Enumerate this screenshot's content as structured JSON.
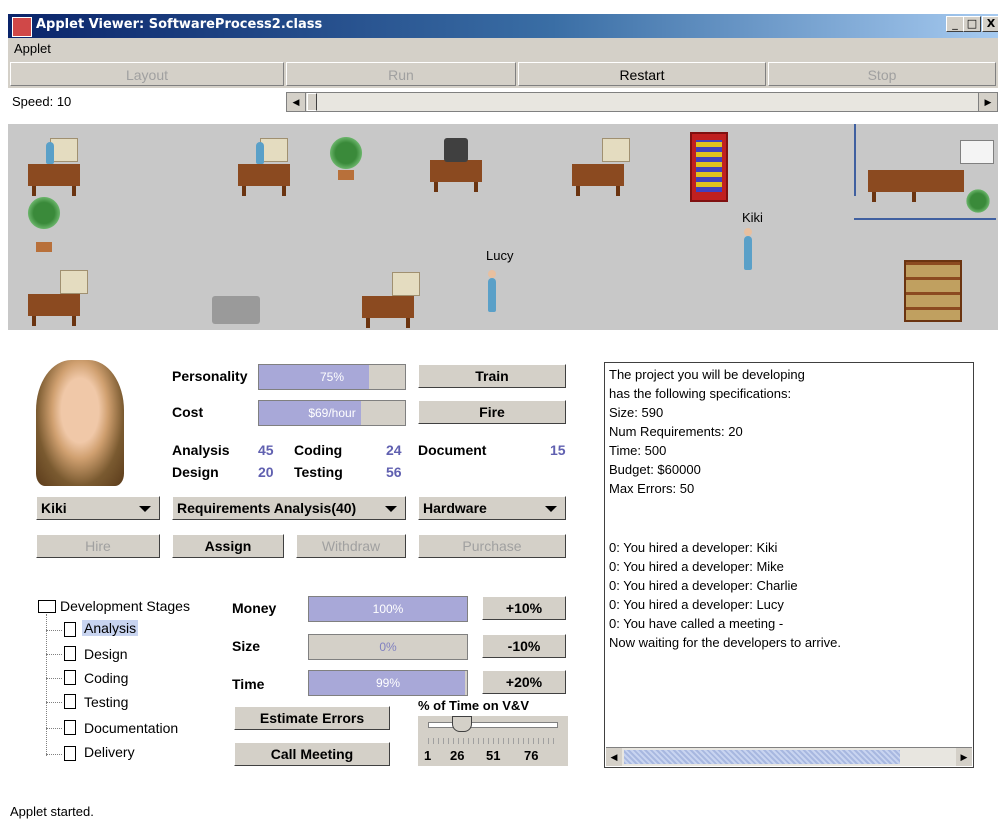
{
  "window": {
    "title": "Applet Viewer: SoftwareProcess2.class",
    "min": "_",
    "max": "□",
    "close": "X"
  },
  "menu": {
    "applet": "Applet"
  },
  "toolbar": {
    "layout": "Layout",
    "run": "Run",
    "restart": "Restart",
    "stop": "Stop"
  },
  "speed": {
    "label": "Speed: 10",
    "value": 10
  },
  "office": {
    "name1": "Kiki",
    "name2": "Lucy"
  },
  "developer": {
    "personality_label": "Personality",
    "personality_value": "75%",
    "personality_fraction": 0.75,
    "cost_label": "Cost",
    "cost_value": "$69/hour",
    "cost_fraction": 0.7,
    "analysis_label": "Analysis",
    "analysis_value": "45",
    "coding_label": "Coding",
    "coding_value": "24",
    "document_label": "Document",
    "document_value": "15",
    "design_label": "Design",
    "design_value": "20",
    "testing_label": "Testing",
    "testing_value": "56"
  },
  "buttons": {
    "train": "Train",
    "fire": "Fire",
    "hire": "Hire",
    "assign": "Assign",
    "withdraw": "Withdraw",
    "purchase": "Purchase",
    "plus10": "+10%",
    "minus10": "-10%",
    "plus20": "+20%",
    "estimate": "Estimate Errors",
    "meeting": "Call Meeting"
  },
  "dropdowns": {
    "developer": "Kiki",
    "task": "Requirements Analysis(40)",
    "item": "Hardware"
  },
  "tree": {
    "root": "Development Stages",
    "items": [
      "Analysis",
      "Design",
      "Coding",
      "Testing",
      "Documentation",
      "Delivery"
    ]
  },
  "resources": {
    "money_label": "Money",
    "money_value": "100%",
    "money_fraction": 1.0,
    "size_label": "Size",
    "size_value": "0%",
    "size_fraction": 0,
    "time_label": "Time",
    "time_value": "99%",
    "time_fraction": 0.99
  },
  "vv": {
    "label": "% of Time on V&V",
    "ticks": [
      "1",
      "26",
      "51",
      "76"
    ]
  },
  "log": {
    "lines": [
      "The project you will be developing",
      "has the following specifications:",
      "Size: 590",
      "Num Requirements: 20",
      "Time: 500",
      "Budget: $60000",
      "Max Errors: 50",
      "",
      "",
      "0: You hired a developer: Kiki",
      "0: You hired a developer: Mike",
      "0: You hired a developer: Charlie",
      "0: You hired a developer: Lucy",
      "0: You have called a meeting -",
      "Now waiting for the developers to arrive."
    ]
  },
  "status": "Applet started.",
  "colors": {
    "title_start": "#0a246a",
    "bar_fill": "#a8a8d8",
    "panel_bg": "#d4d0c8",
    "office_floor": "#c8c8c8"
  }
}
